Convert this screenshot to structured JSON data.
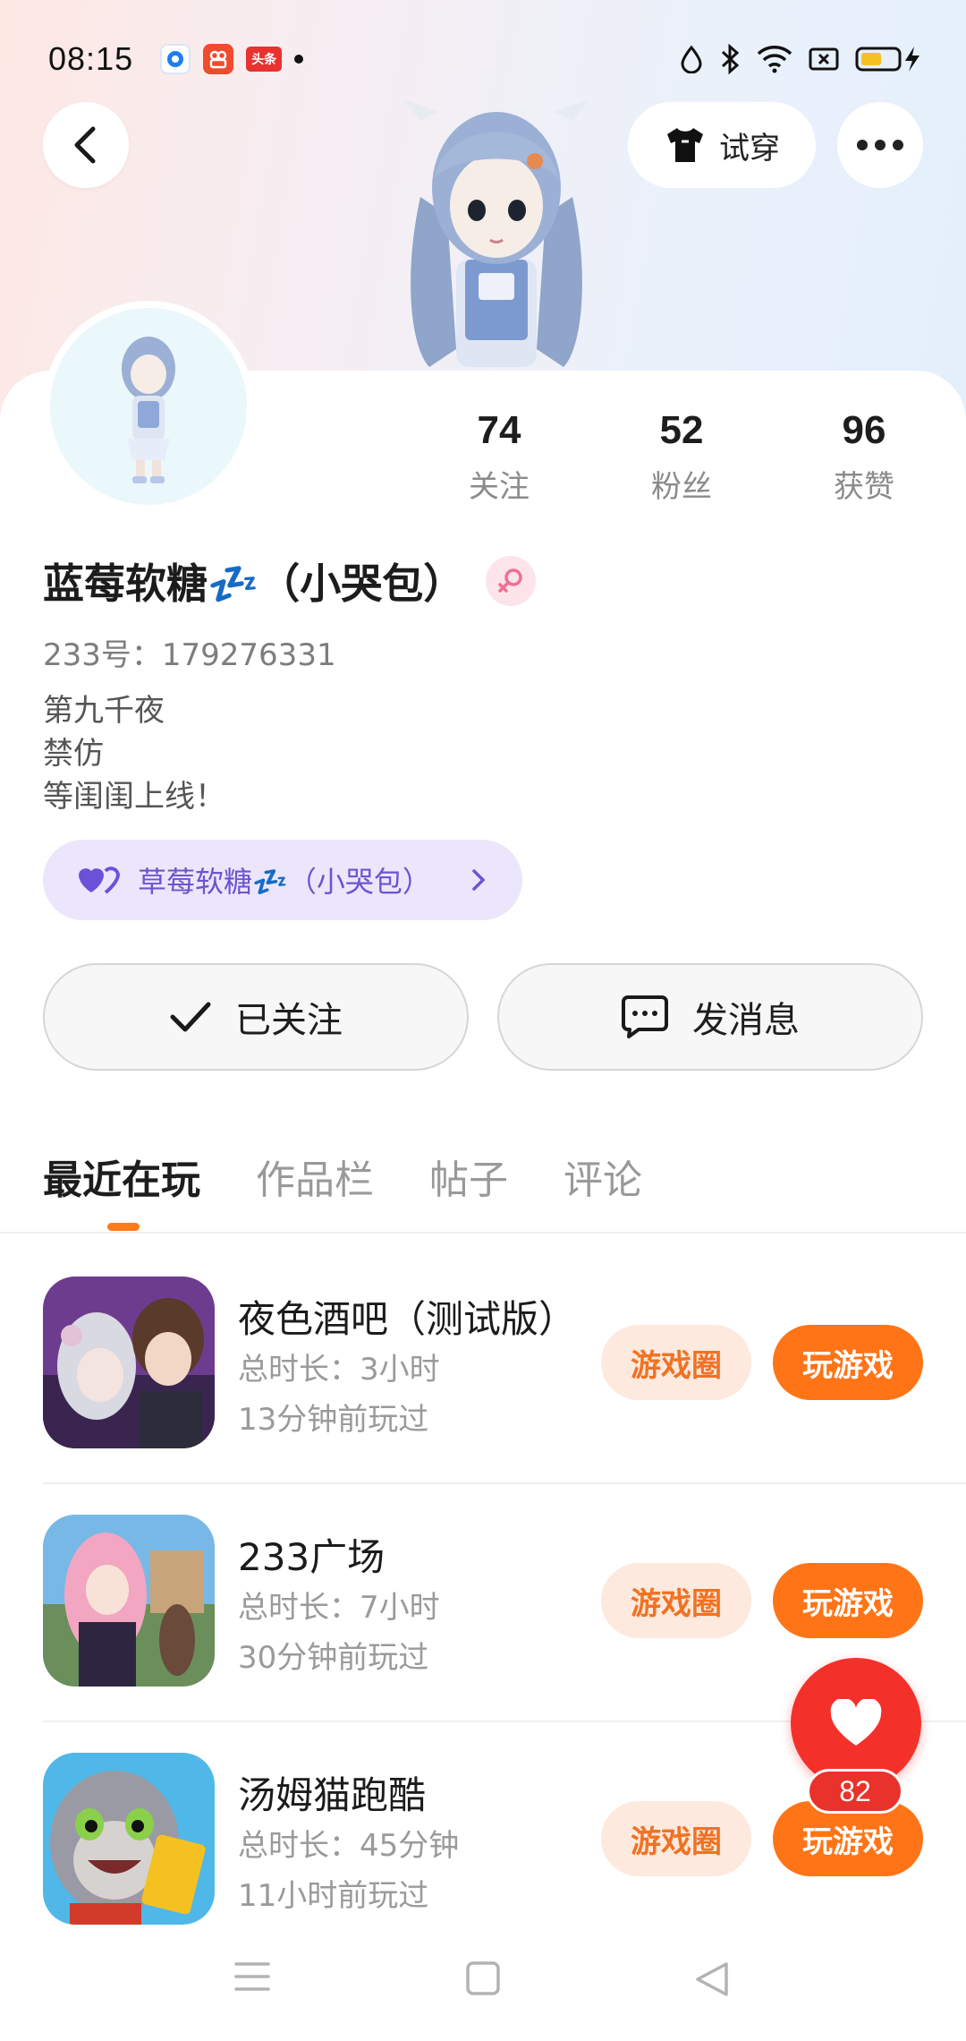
{
  "status_bar": {
    "time": "08:15",
    "app2_label": "",
    "app3_label": "头条"
  },
  "header": {
    "tryon_label": "试穿"
  },
  "profile": {
    "stats": [
      {
        "value": "74",
        "label": "关注"
      },
      {
        "value": "52",
        "label": "粉丝"
      },
      {
        "value": "96",
        "label": "获赞"
      }
    ],
    "nickname": "蓝莓软糖💤（小哭包）",
    "uid": "233号：179276331",
    "bio": [
      "第九千夜",
      "禁仿",
      "等闺闺上线！"
    ],
    "cp_label": "草莓软糖💤（小哭包）"
  },
  "actions": {
    "follow_label": "已关注",
    "message_label": "发消息"
  },
  "tabs": [
    {
      "label": "最近在玩",
      "active": true
    },
    {
      "label": "作品栏",
      "active": false
    },
    {
      "label": "帖子",
      "active": false
    },
    {
      "label": "评论",
      "active": false
    }
  ],
  "games": [
    {
      "name": "夜色酒吧（测试版）",
      "duration": "总时长：3小时",
      "last_played": "13分钟前玩过",
      "circle_label": "游戏圈",
      "play_label": "玩游戏"
    },
    {
      "name": "233广场",
      "duration": "总时长：7小时",
      "last_played": "30分钟前玩过",
      "circle_label": "游戏圈",
      "play_label": "玩游戏"
    },
    {
      "name": "汤姆猫跑酷",
      "duration": "总时长：45分钟",
      "last_played": "11小时前玩过",
      "circle_label": "游戏圈",
      "play_label": "玩游戏"
    }
  ],
  "fab": {
    "like_count": "82"
  },
  "colors": {
    "accent_orange": "#ff7416",
    "circle_bg": "#fde9dd",
    "cp_purple": "#6b55d1",
    "like_red": "#f4302a"
  }
}
